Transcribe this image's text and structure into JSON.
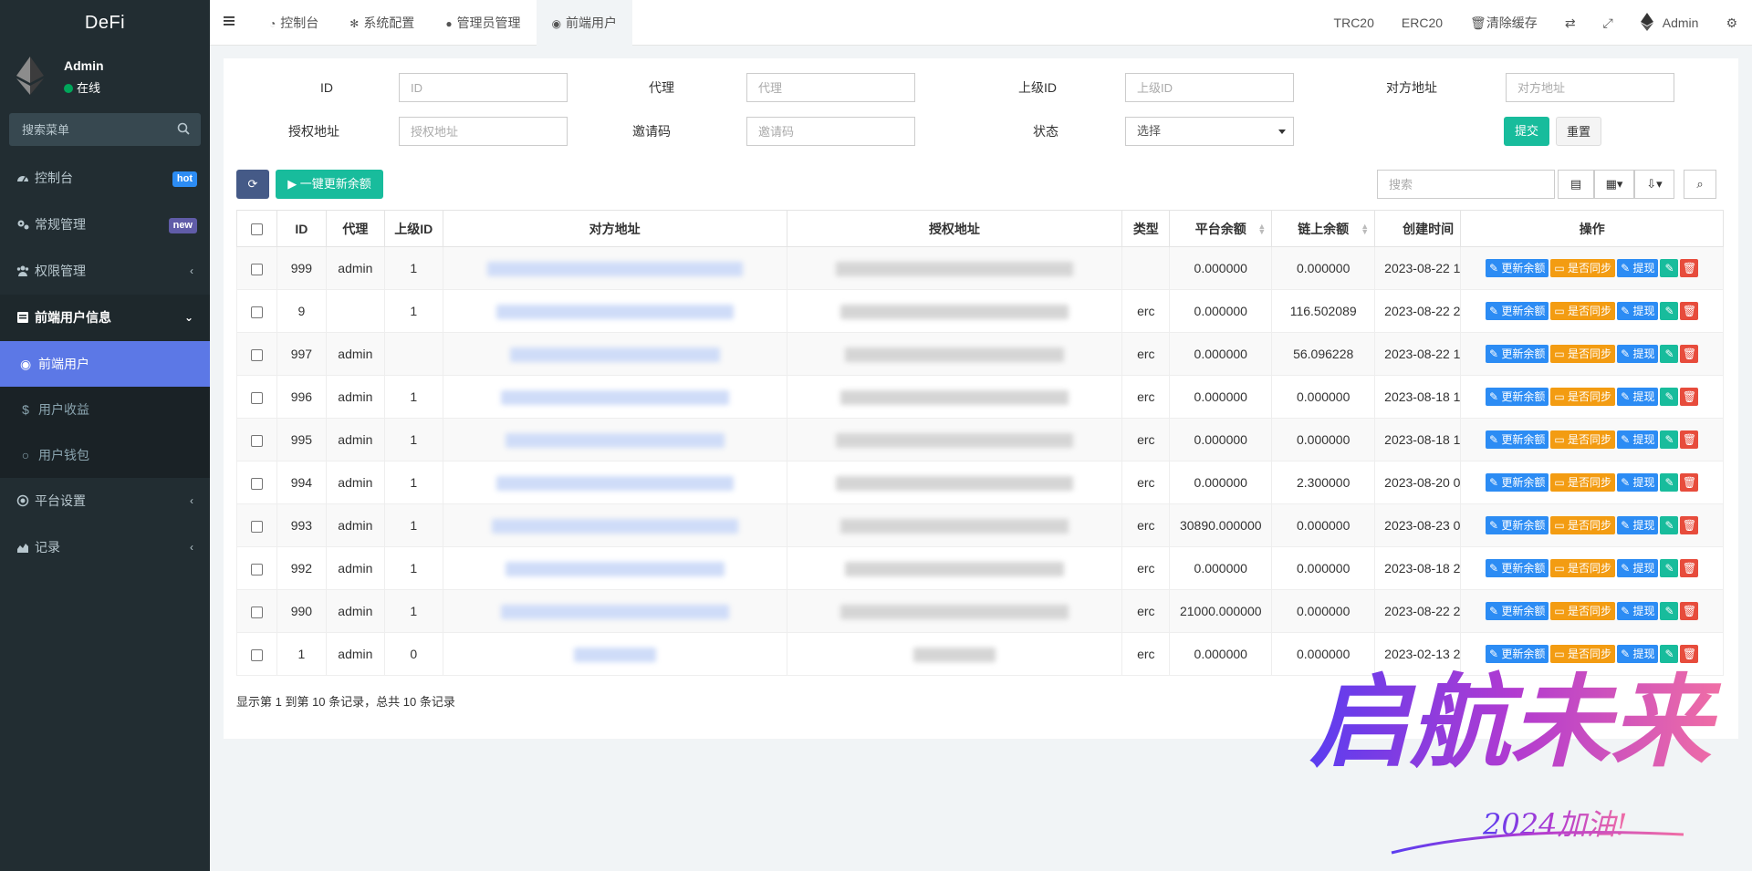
{
  "sidebar": {
    "logo": "DeFi",
    "user": {
      "name": "Admin",
      "status": "在线"
    },
    "search_placeholder": "搜索菜单",
    "menu": [
      {
        "label": "控制台",
        "icon": "dashboard-icon",
        "badge": "hot",
        "badge_color": "#2c8cf4"
      },
      {
        "label": "常规管理",
        "icon": "cogs-icon",
        "badge": "new",
        "badge_color": "#605ca8"
      },
      {
        "label": "权限管理",
        "icon": "group-icon",
        "chevron": "‹"
      },
      {
        "label": "前端用户信息",
        "icon": "list-alt-icon",
        "chevron": "⌄",
        "open": true
      }
    ],
    "submenu": [
      {
        "label": "前端用户",
        "icon": "user-icon",
        "active": true
      },
      {
        "label": "用户收益",
        "icon": "dollar-icon"
      },
      {
        "label": "用户钱包",
        "icon": "circle-icon"
      }
    ],
    "menu_after": [
      {
        "label": "平台设置",
        "icon": "circle-dot-icon",
        "chevron": "‹"
      },
      {
        "label": "记录",
        "icon": "area-chart-icon",
        "chevron": "‹"
      }
    ]
  },
  "topbar": {
    "tabs": [
      {
        "label": "控制台",
        "icon": "dashboard-icon"
      },
      {
        "label": "系统配置",
        "icon": "gear-icon"
      },
      {
        "label": "管理员管理",
        "icon": "user-icon"
      },
      {
        "label": "前端用户",
        "icon": "user-circle-icon",
        "active": true
      }
    ],
    "right": {
      "trc20": "TRC20",
      "erc20": "ERC20",
      "clear_cache": "清除缓存",
      "user": "Admin"
    }
  },
  "filter": {
    "id_label": "ID",
    "id_placeholder": "ID",
    "agent_label": "代理",
    "agent_placeholder": "代理",
    "parent_label": "上级ID",
    "parent_placeholder": "上级ID",
    "counter_label": "对方地址",
    "counter_placeholder": "对方地址",
    "auth_label": "授权地址",
    "auth_placeholder": "授权地址",
    "invite_label": "邀请码",
    "invite_placeholder": "邀请码",
    "status_label": "状态",
    "status_value": "选择",
    "submit": "提交",
    "reset": "重置"
  },
  "toolbar": {
    "update_all": "▶ 一键更新余额",
    "search_placeholder": "搜索"
  },
  "table": {
    "headers": [
      "ID",
      "代理",
      "上级ID",
      "对方地址",
      "授权地址",
      "类型",
      "平台余额",
      "链上余额",
      "创建时间",
      "操作"
    ],
    "ops": {
      "update": "更新余额",
      "sync": "是否同步",
      "withdraw": "提现"
    },
    "rows": [
      {
        "id": "999",
        "agent": "admin",
        "parent": "1",
        "counter": "",
        "auth": "",
        "type": "",
        "platform": "0.000000",
        "chain": "0.000000",
        "created": "2023-08-22 1"
      },
      {
        "id": "9",
        "agent": "",
        "parent": "1",
        "counter": "0x567b6 a796",
        "auth": "0x2F Dd31AFDD",
        "type": "erc",
        "platform": "0.000000",
        "chain": "116.502089",
        "created": "2023-08-22 2"
      },
      {
        "id": "997",
        "agent": "admin",
        "parent": "",
        "counter": "0x 08d615E",
        "auth": "F5 95309cF80 f5 AFDD",
        "type": "erc",
        "platform": "0.000000",
        "chain": "56.096228",
        "created": "2023-08-22 1"
      },
      {
        "id": "996",
        "agent": "admin",
        "parent": "1",
        "counter": "0xB2 7 0b2 ED 20475",
        "auth": "0x2F c95309cF f2d DD",
        "type": "erc",
        "platform": "0.000000",
        "chain": "0.000000",
        "created": "2023-08-18 1"
      },
      {
        "id": "995",
        "agent": "admin",
        "parent": "1",
        "counter": "0x 4B F4",
        "auth": "0x2 5Fc9530 AD",
        "type": "erc",
        "platform": "0.000000",
        "chain": "0.000000",
        "created": "2023-08-18 1"
      },
      {
        "id": "994",
        "agent": "admin",
        "parent": "1",
        "counter": "0 8 3D4a",
        "auth": "0x F5Fc9 33b",
        "type": "erc",
        "platform": "0.000000",
        "chain": "2.300000",
        "created": "2023-08-20 0"
      },
      {
        "id": "993",
        "agent": "admin",
        "parent": "1",
        "counter": "0 F Fb0b571",
        "auth": "0 80 f",
        "type": "erc",
        "platform": "30890.000000",
        "chain": "0.000000",
        "created": "2023-08-23 0"
      },
      {
        "id": "992",
        "agent": "admin",
        "parent": "1",
        "counter": "0x f2 d31AFDD",
        "auth": "9cF8 3b 6 D",
        "type": "erc",
        "platform": "0.000000",
        "chain": "0.000000",
        "created": "2023-08-18 2"
      },
      {
        "id": "990",
        "agent": "admin",
        "parent": "1",
        "counter": "0 2 D 619 1 d1146513f9b",
        "auth": "0x2F5 5309cF80 bcf6 DD",
        "type": "erc",
        "platform": "21000.000000",
        "chain": "0.000000",
        "created": "2023-08-22 2"
      },
      {
        "id": "1",
        "agent": "admin",
        "parent": "0",
        "counter": "",
        "auth": "",
        "type": "erc",
        "platform": "0.000000",
        "chain": "0.000000",
        "created": "2023-02-13 2"
      }
    ]
  },
  "footer": "显示第 1 到第 10 条记录，总共 10 条记录",
  "watermark": {
    "title": "启航未来",
    "subtitle": "2024加油!"
  }
}
